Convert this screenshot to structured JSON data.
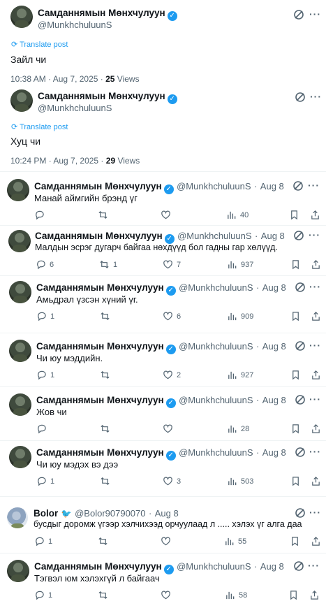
{
  "user": {
    "name": "Самданнямын Мөнхчулуун",
    "handle": "@MunkhchuluunS",
    "verified_badge": "✓"
  },
  "ui": {
    "translate": "Translate post",
    "more": "···",
    "views_label": "Views",
    "sep": "·"
  },
  "main_posts": [
    {
      "text": "Зайл чи",
      "time": "10:38 AM · Aug 7, 2025 · ",
      "views": "25"
    },
    {
      "text": "Хуц чи",
      "time": "10:24 PM · Aug 7, 2025 · ",
      "views": "29"
    }
  ],
  "replies": [
    {
      "name": "Самданнямын Мөнхчулуун",
      "handle": "@MunkhchuluunS",
      "date": "Aug 8",
      "text": "Манай аймгийн брэнд үг",
      "replies": "",
      "reposts": "",
      "likes": "",
      "views": "40"
    },
    {
      "name": "Самданнямын Мөнхчулуун",
      "handle": "@MunkhchuluunS",
      "date": "Aug 8",
      "text": "Малдын эсрэг дугарч байгаа нөхдүүд бол гадны гар хөлүүд.",
      "replies": "6",
      "reposts": "1",
      "likes": "7",
      "views": "937"
    },
    {
      "name": "Самданнямын Мөнхчулуун",
      "handle": "@MunkhchuluunS",
      "date": "Aug 8",
      "text": "Амьдрал үзсэн хүний үг.",
      "replies": "1",
      "reposts": "",
      "likes": "6",
      "views": "909"
    },
    {
      "name": "Самданнямын Мөнхчулуун",
      "handle": "@MunkhchuluunS",
      "date": "Aug 8",
      "text": "Чи юу мэддийн.",
      "replies": "1",
      "reposts": "",
      "likes": "2",
      "views": "927"
    },
    {
      "name": "Самданнямын Мөнхчулуун",
      "handle": "@MunkhchuluunS",
      "date": "Aug 8",
      "text": "Жов чи",
      "replies": "",
      "reposts": "",
      "likes": "",
      "views": "28"
    },
    {
      "name": "Самданнямын Мөнхчулуун",
      "handle": "@MunkhchuluunS",
      "date": "Aug 8",
      "text": "Чи юу мэдэх вэ дээ",
      "replies": "1",
      "reposts": "",
      "likes": "3",
      "views": "503"
    },
    {
      "name": "Bolor",
      "handle": "@Bolor90790070",
      "date": "Aug 8",
      "text": "бусдыг доромж үгээр хэлчихээд орчуулаад л ..... хэлэх үг алга даа",
      "replies": "1",
      "reposts": "",
      "likes": "",
      "views": "55"
    },
    {
      "name": "Самданнямын Мөнхчулуун",
      "handle": "@MunkhchuluunS",
      "date": "Aug 8",
      "text": "Тэгвэл юм хэлэхгүй л байгаач",
      "replies": "1",
      "reposts": "",
      "likes": "",
      "views": "58"
    }
  ],
  "icons": {
    "grok": "grok-icon",
    "reply": "reply-icon",
    "repost": "repost-icon",
    "like": "like-icon",
    "views": "views-icon",
    "bookmark": "bookmark-icon",
    "share": "share-icon",
    "translate": "translate-icon",
    "bird": "bird-icon"
  },
  "colors": {
    "accent": "#1d9bf0",
    "text": "#0f1419",
    "muted": "#536471",
    "divider": "#eff3f4"
  }
}
